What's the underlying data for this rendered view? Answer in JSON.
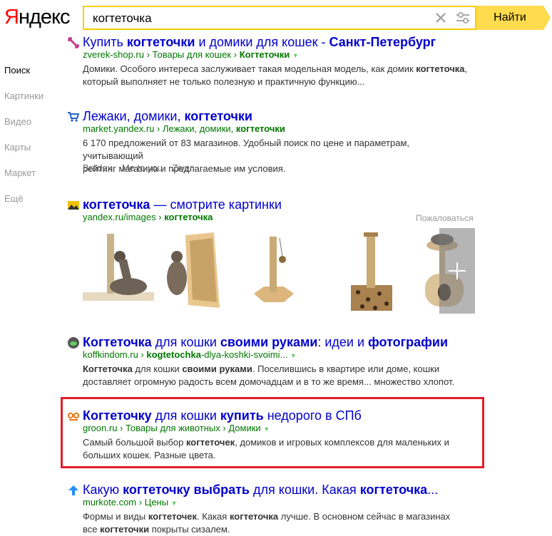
{
  "header": {
    "logo_first": "Я",
    "logo_rest": "ндекс",
    "search_query": "когтеточка",
    "search_button": "Найти"
  },
  "sidebar": {
    "items": [
      {
        "label": "Поиск",
        "active": true
      },
      {
        "label": "Картинки"
      },
      {
        "label": "Видео"
      },
      {
        "label": "Карты"
      },
      {
        "label": "Маркет"
      },
      {
        "label": "Ещё"
      }
    ]
  },
  "results": [
    {
      "title_parts": [
        "Купить ",
        "когтеточки",
        " и домики для кошек - ",
        "Санкт-Петербург"
      ],
      "url_parts": [
        "zverek-shop.ru",
        " › ",
        "Товары для кошек",
        " › ",
        "Когтеточки"
      ],
      "text": "Домики. Особого интереса заслуживает такая модельная модель, как домик когтеточка, который выполняет не только полезную и практичную функцию..."
    },
    {
      "title_parts": [
        "Лежаки, домики, ",
        "когтеточки"
      ],
      "url_parts": [
        "market.yandex.ru",
        " › ",
        "Лежаки, домики, ",
        "когтеточки"
      ],
      "text_lines": [
        "6 170 предложений от 83 магазинов. Удобный поиск по цене и параметрам, учитывающий",
        "рейтинг магазина и предлагаемые им условия."
      ],
      "sitelinks": [
        "Bradex",
        "Me to you",
        "Ziver"
      ]
    },
    {
      "title_parts": [
        "когтеточка",
        " — смотрите картинки"
      ],
      "url_parts": [
        "yandex.ru/images",
        " › ",
        "когтеточка"
      ],
      "complain": "Пожаловаться"
    },
    {
      "title_parts": [
        "Когтеточка",
        " для кошки ",
        "своими руками",
        ": идеи и ",
        "фотографии"
      ],
      "url_parts": [
        "koffkindom.ru",
        " › ",
        "kogtetochka",
        "-dlya-koshki-svoimi..."
      ],
      "text_lines": [
        "Когтеточка",
        " для кошки ",
        "своими руками",
        ". Поселившись в квартире или доме, кошки",
        "доставляет огромную радость всем домочадцам и в то же время... множество хлопот."
      ]
    },
    {
      "title_parts": [
        "Когтеточку",
        " для кошки ",
        "купить",
        " недорого в СПб"
      ],
      "url_parts": [
        "groon.ru",
        " › ",
        "Товары для животных",
        " › ",
        "Домики"
      ],
      "text_lines": [
        "Самый большой выбор ",
        "когтеточек",
        ", домиков и игровых комплексов для маленьких и",
        "больших кошек. Разные цвета."
      ]
    },
    {
      "title_parts": [
        "Какую ",
        "когтеточку",
        " ",
        "выбрать",
        " для кошки. Какая ",
        "когтеточка",
        "..."
      ],
      "url_parts": [
        "murkote.com",
        " › ",
        "Цены"
      ],
      "text_lines": [
        "Формы и виды ",
        "когтеточек",
        ". Какая ",
        "когтеточка",
        " лучше. В основном сейчас в магазинах",
        "все ",
        "когтеточки",
        " покрыты сизалем."
      ]
    }
  ],
  "colors": {
    "link": "#0000cc",
    "url": "#007700",
    "highlight_border": "#e21e2b",
    "search_button": "#ffdb4d",
    "search_border": "#ffcc00"
  },
  "icons": [
    "bone-icon",
    "cart-icon",
    "image-icon",
    "site-favicon",
    "groon-favicon",
    "arrow-up-icon",
    "clear-icon",
    "settings-icon"
  ]
}
